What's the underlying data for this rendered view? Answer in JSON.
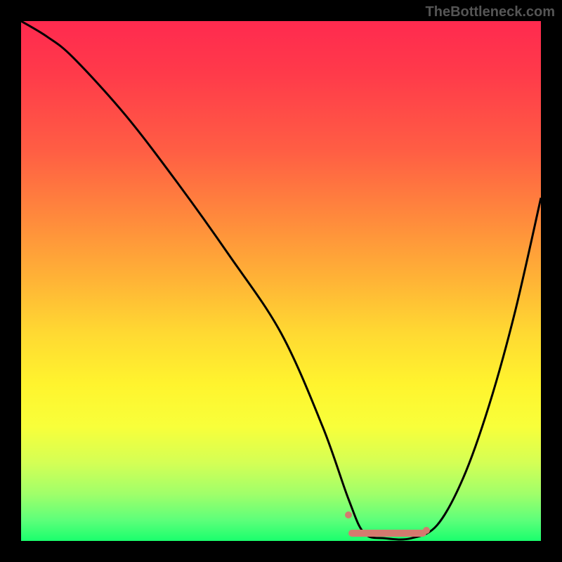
{
  "watermark": "TheBottleneck.com",
  "chart_data": {
    "type": "line",
    "title": "",
    "xlabel": "",
    "ylabel": "",
    "xlim": [
      0,
      100
    ],
    "ylim": [
      0,
      100
    ],
    "series": [
      {
        "name": "curve",
        "x": [
          0,
          5,
          10,
          20,
          30,
          40,
          50,
          58,
          63,
          66,
          70,
          75,
          80,
          85,
          90,
          95,
          100
        ],
        "y": [
          100,
          97,
          93,
          82,
          69,
          55,
          40,
          22,
          8,
          1.5,
          0.5,
          0.5,
          3,
          12,
          26,
          44,
          66
        ]
      }
    ],
    "highlight_segment": {
      "x_start": 63,
      "x_end": 78,
      "y": 1.5
    },
    "highlight_dots": [
      {
        "x": 63,
        "y": 5
      },
      {
        "x": 78,
        "y": 2
      }
    ],
    "background_gradient": {
      "top": "#ff2a4f",
      "bottom": "#1aff6d"
    }
  }
}
